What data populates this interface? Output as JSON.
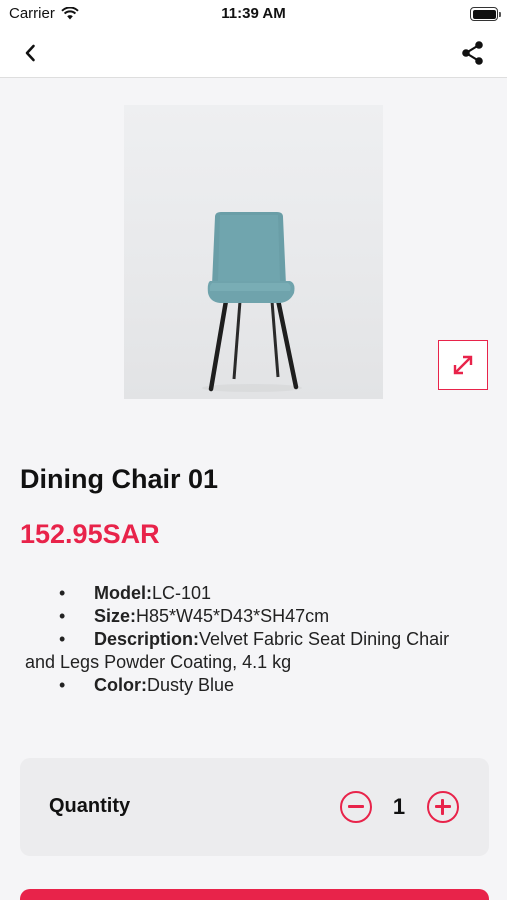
{
  "status_bar": {
    "carrier": "Carrier",
    "time": "11:39 AM"
  },
  "nav": {
    "back_icon": "chevron-left-icon",
    "share_icon": "share-icon"
  },
  "product": {
    "name": "Dining Chair 01",
    "price": "152.95SAR",
    "expand_icon": "expand-arrows-icon",
    "details": [
      {
        "label": "Model:",
        "value": "LC-101"
      },
      {
        "label": "Size:",
        "value": "H85*W45*D43*SH47cm"
      },
      {
        "label": "Description:",
        "value": "Velvet Fabric Seat Dining Chair",
        "value_cont": "and Legs Powder Coating, 4.1 kg"
      },
      {
        "label": "Color:",
        "value": "Dusty Blue"
      }
    ],
    "bullet": "•"
  },
  "quantity": {
    "label": "Quantity",
    "value": "1"
  },
  "colors": {
    "accent": "#e8234a",
    "chair_seat": "#6fa3ac"
  }
}
